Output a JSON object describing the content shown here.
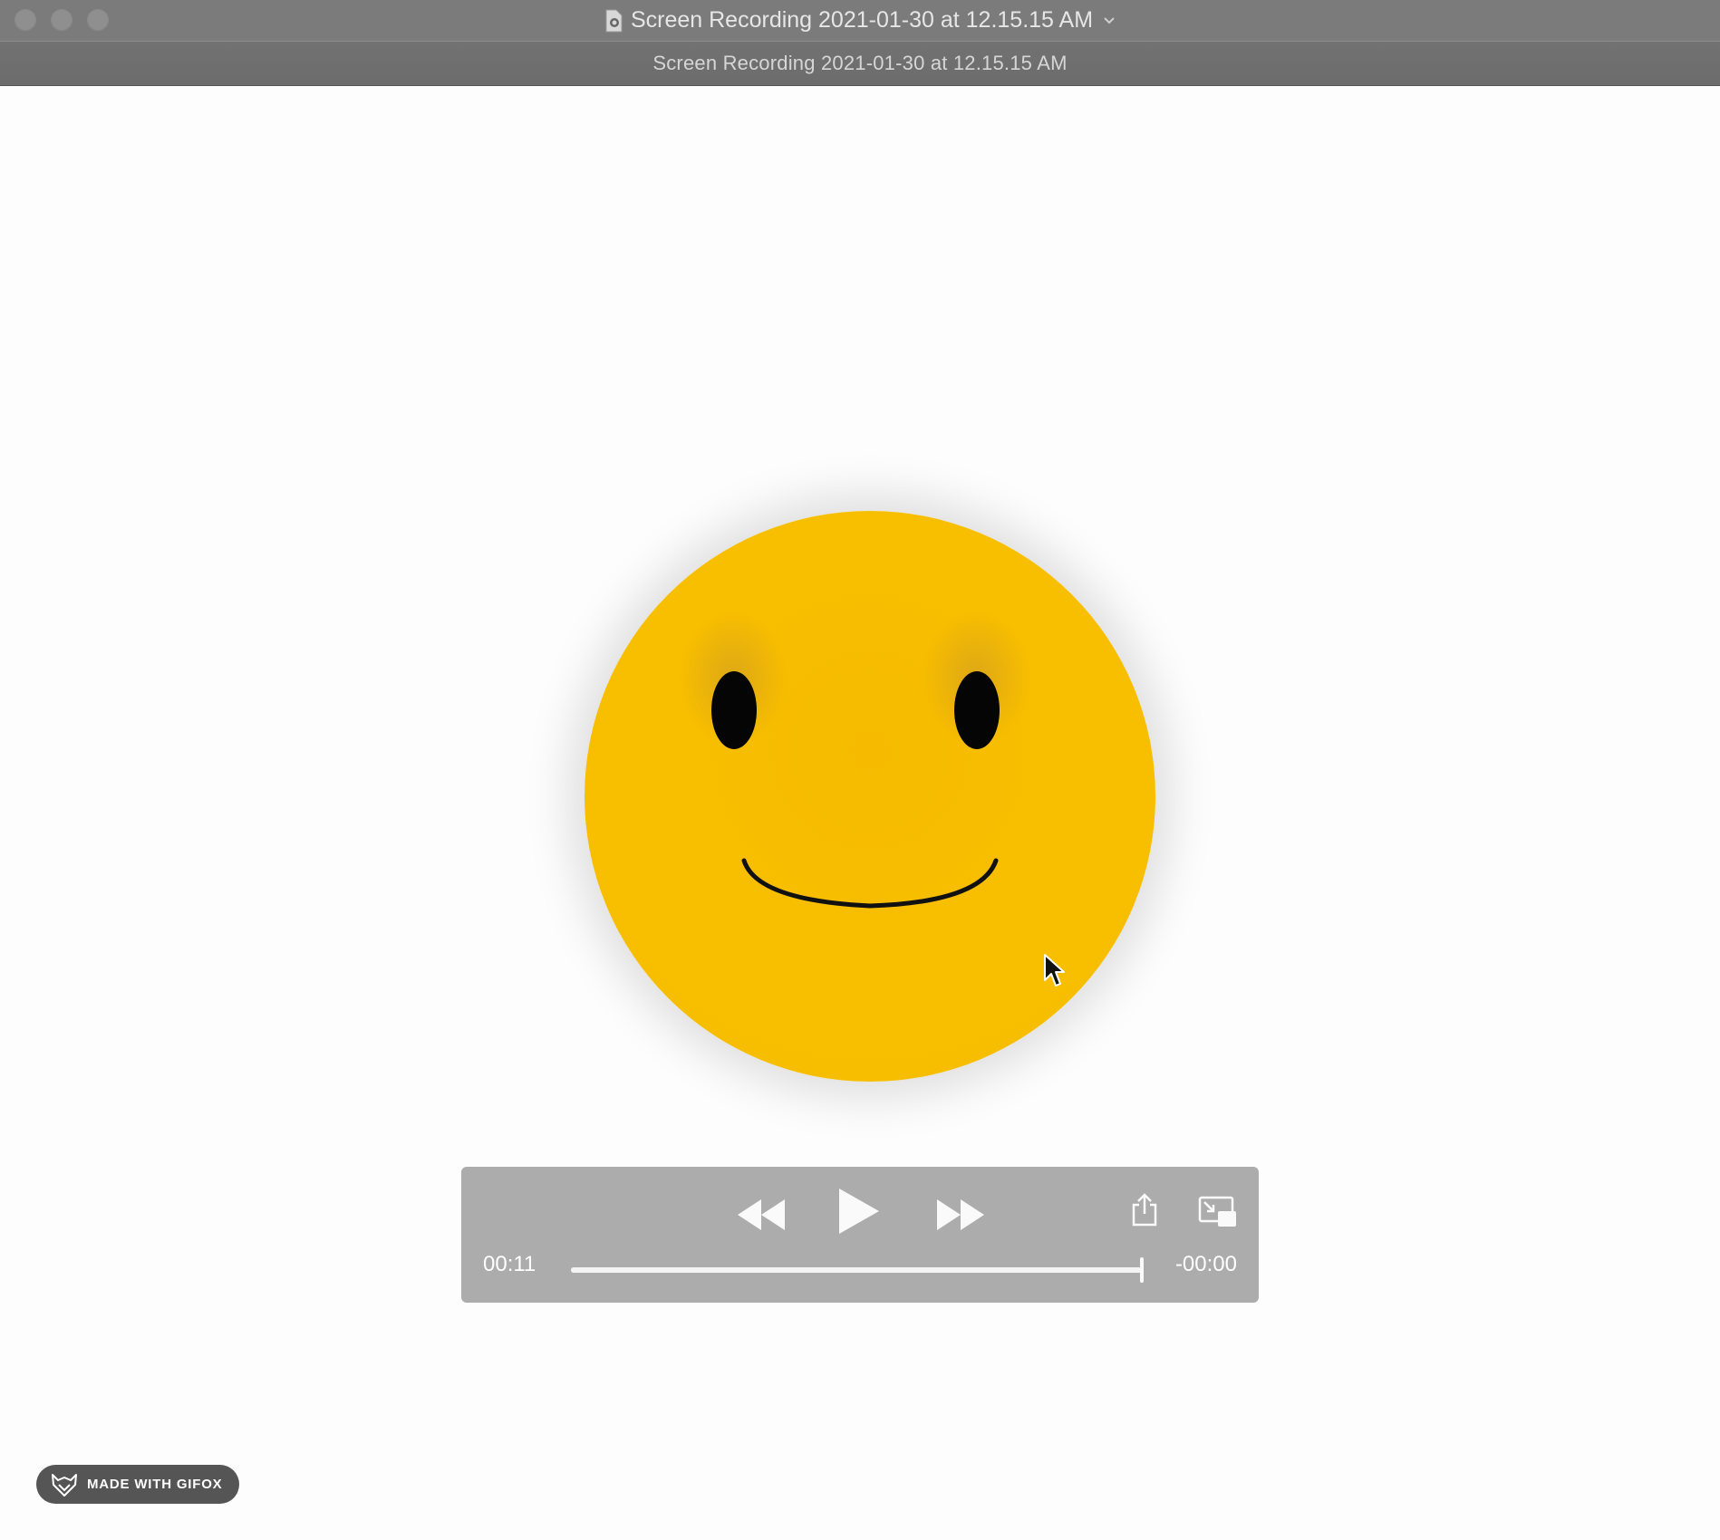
{
  "window": {
    "title": "Screen Recording 2021-01-30 at 12.15.15 AM",
    "subtitle": "Screen Recording 2021-01-30 at 12.15.15 AM"
  },
  "player": {
    "current_time": "00:11",
    "remaining_time": "-00:00",
    "progress": 1.0,
    "buttons": [
      "rewind-icon",
      "play-icon",
      "fast-forward-icon",
      "share-icon",
      "picture-in-picture-icon"
    ]
  },
  "watermark": {
    "label": "MADE WITH GIFOX"
  },
  "colors": {
    "face": "#f8bf00",
    "controls_bg": "#acacac",
    "titlebar": "#7b7b7b"
  }
}
